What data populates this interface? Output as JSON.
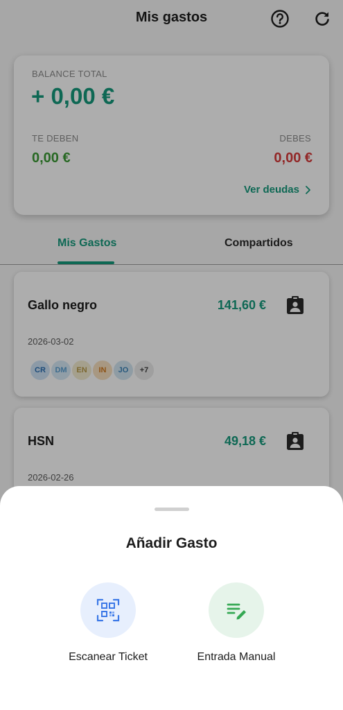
{
  "header": {
    "title": "Mis gastos"
  },
  "balance": {
    "total_label": "BALANCE TOTAL",
    "total_value": "+ 0,00 €",
    "owed_label": "TE DEBEN",
    "owed_value": "0,00 €",
    "owe_label": "DEBES",
    "owe_value": "0,00 €",
    "link_label": "Ver deudas"
  },
  "tabs": [
    {
      "label": "Mis Gastos",
      "active": true
    },
    {
      "label": "Compartidos",
      "active": false
    }
  ],
  "expenses": [
    {
      "name": "Gallo negro",
      "amount": "141,60 €",
      "date": "2026-03-02",
      "avatars": [
        {
          "initials": "CR",
          "bg": "#cfe3f6",
          "fg": "#2b6fb3"
        },
        {
          "initials": "DM",
          "bg": "#d6e9f6",
          "fg": "#5a9ed0"
        },
        {
          "initials": "EN",
          "bg": "#f3ecd0",
          "fg": "#b79a4a"
        },
        {
          "initials": "IN",
          "bg": "#f8e0c0",
          "fg": "#d07a20"
        },
        {
          "initials": "JO",
          "bg": "#d3e6f2",
          "fg": "#3c84b8"
        },
        {
          "initials": "+7",
          "bg": "#eaeaea",
          "fg": "#444444"
        }
      ]
    },
    {
      "name": "HSN",
      "amount": "49,18 €",
      "date": "2026-02-26"
    }
  ],
  "sheet": {
    "title": "Añadir Gasto",
    "options": [
      {
        "label": "Escanear Ticket",
        "icon": "qr-scan-icon"
      },
      {
        "label": "Entrada Manual",
        "icon": "manual-edit-icon"
      }
    ]
  },
  "colors": {
    "accent": "#159a7c",
    "positive": "#3a9a34",
    "negative": "#d83a3a",
    "scan_icon": "#3b78e7",
    "manual_icon": "#34a853"
  }
}
